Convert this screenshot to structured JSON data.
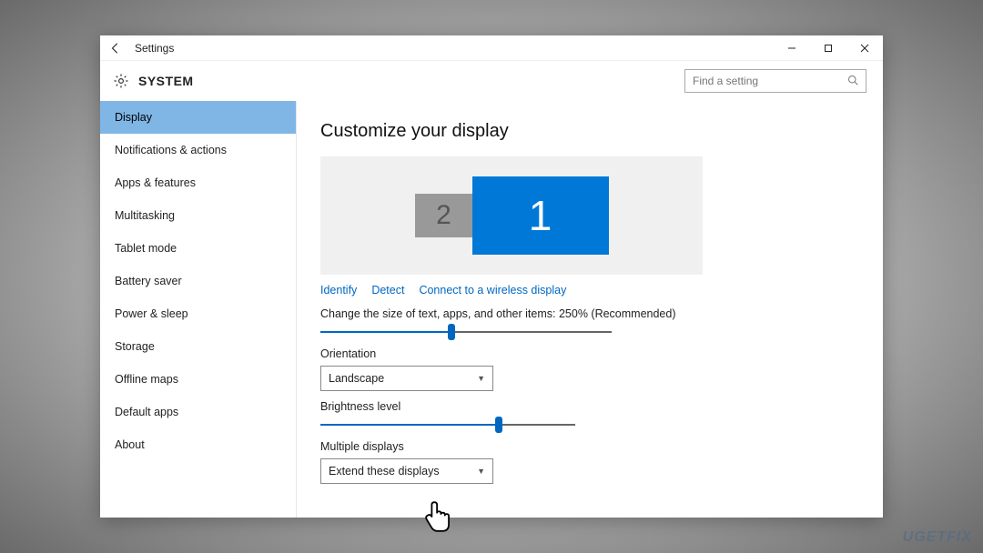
{
  "titlebar": {
    "app_name": "Settings"
  },
  "header": {
    "title": "SYSTEM",
    "search_placeholder": "Find a setting"
  },
  "sidebar": {
    "items": [
      {
        "label": "Display",
        "selected": true
      },
      {
        "label": "Notifications & actions",
        "selected": false
      },
      {
        "label": "Apps & features",
        "selected": false
      },
      {
        "label": "Multitasking",
        "selected": false
      },
      {
        "label": "Tablet mode",
        "selected": false
      },
      {
        "label": "Battery saver",
        "selected": false
      },
      {
        "label": "Power & sleep",
        "selected": false
      },
      {
        "label": "Storage",
        "selected": false
      },
      {
        "label": "Offline maps",
        "selected": false
      },
      {
        "label": "Default apps",
        "selected": false
      },
      {
        "label": "About",
        "selected": false
      }
    ]
  },
  "content": {
    "page_title": "Customize your display",
    "monitors": {
      "primary_label": "1",
      "secondary_label": "2"
    },
    "links": {
      "identify": "Identify",
      "detect": "Detect",
      "wireless": "Connect to a wireless display"
    },
    "scale_label": "Change the size of text, apps, and other items: 250% (Recommended)",
    "scale_slider_percent": 45,
    "orientation": {
      "label": "Orientation",
      "value": "Landscape"
    },
    "brightness": {
      "label": "Brightness level",
      "slider_percent": 70
    },
    "multiple": {
      "label": "Multiple displays",
      "value": "Extend these displays"
    }
  },
  "watermark": "UGETFIX"
}
